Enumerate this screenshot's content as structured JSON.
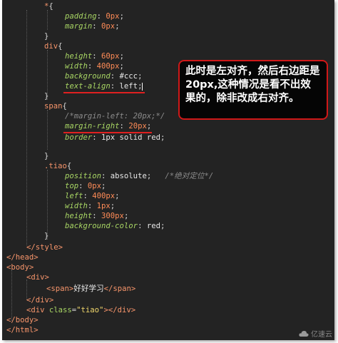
{
  "code": {
    "l0": {
      "sel": "*",
      "brace": "{"
    },
    "l1": {
      "prop": "padding",
      "value": "0px",
      "semi": ";"
    },
    "l2": {
      "prop": "margin",
      "value": "0px",
      "semi": ";"
    },
    "l3": {
      "brace": "}"
    },
    "l4": {
      "sel": "div",
      "brace": "{"
    },
    "l5": {
      "prop": "height",
      "value": "60px",
      "semi": ";"
    },
    "l6": {
      "prop": "width",
      "value": "400px",
      "semi": ";"
    },
    "l7": {
      "prop": "background",
      "value": "#ccc",
      "semi": ";"
    },
    "l8": {
      "prop": "text-align",
      "value": "left",
      "semi": ";"
    },
    "l9": {
      "brace": "}"
    },
    "l10": {
      "sel": "span",
      "brace": "{"
    },
    "l11": {
      "comment": "/*margin-left: 20px;*/"
    },
    "l12": {
      "prop": "margin-right",
      "value": "20px",
      "semi": ";"
    },
    "l13": {
      "prop": "border",
      "value": "1px solid red",
      "semi": ";"
    },
    "l14": {
      "brace": "}"
    },
    "l15": {
      "sel": ".tiao",
      "brace": "{"
    },
    "l16": {
      "prop": "position",
      "value": "absolute",
      "semi": ";",
      "comment": "/*绝对定位*/"
    },
    "l17": {
      "prop": "top",
      "value": "0px",
      "semi": ";"
    },
    "l18": {
      "prop": "left",
      "value": "400px",
      "semi": ";"
    },
    "l19": {
      "prop": "width",
      "value": "1px",
      "semi": ";"
    },
    "l20": {
      "prop": "height",
      "value": "300px",
      "semi": ";"
    },
    "l21": {
      "prop": "background-color",
      "value": "red",
      "semi": ";"
    },
    "l22": {
      "brace": "}"
    },
    "l23": {
      "tag": "</style>"
    },
    "l24": {
      "tag": "</head>"
    },
    "l25": {
      "tag": "<body>"
    },
    "l26": {
      "tag": "<div>"
    },
    "l27": {
      "open": "<span>",
      "text": "好好学习",
      "close": "</span>"
    },
    "l28": {
      "tag": "</div>"
    },
    "l29": {
      "open_a": "<div ",
      "attr": "class",
      "eq": "=",
      "val": "\"tiao\"",
      "open_b": ">",
      "close": "</div>"
    },
    "l30": {
      "tag": "</body>"
    },
    "l31": {
      "tag": "</html>"
    }
  },
  "callout": {
    "text": "此时是左对齐，然后右边距是20px,这种情况是看不出效果的，除非改成右对齐。",
    "border_color": "#d01818"
  },
  "watermark": {
    "label": "亿速云",
    "icon": "cloud-logo-icon"
  },
  "colors": {
    "editor_bg": "#232323",
    "selector": "#f7956b",
    "property": "#a8d664",
    "value": "#ff8c57",
    "string": "#f0d66b",
    "underline": "#e02020"
  }
}
